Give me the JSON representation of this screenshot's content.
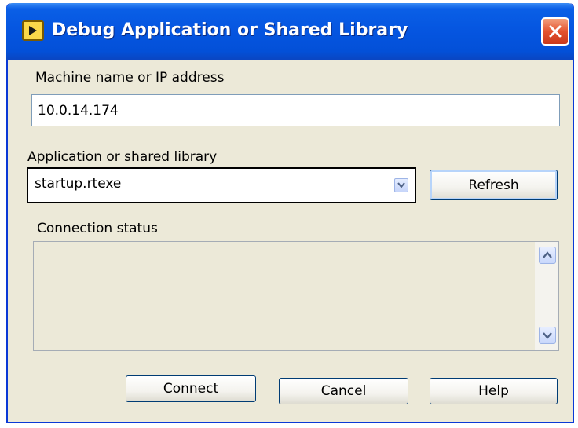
{
  "window": {
    "title": "Debug Application or Shared Library",
    "icons": {
      "app": "labview-run-icon",
      "close": "close-icon"
    },
    "colors": {
      "titlebar": "#0555e0",
      "body": "#ece9d8",
      "close": "#e4532f"
    }
  },
  "machine": {
    "label": "Machine name or IP address",
    "value": "10.0.14.174"
  },
  "application": {
    "label": "Application or shared library",
    "selected": "startup.rtexe",
    "refresh_label": "Refresh"
  },
  "status": {
    "label": "Connection status",
    "text": ""
  },
  "footer": {
    "connect_label": "Connect",
    "cancel_label": "Cancel",
    "help_label": "Help"
  }
}
